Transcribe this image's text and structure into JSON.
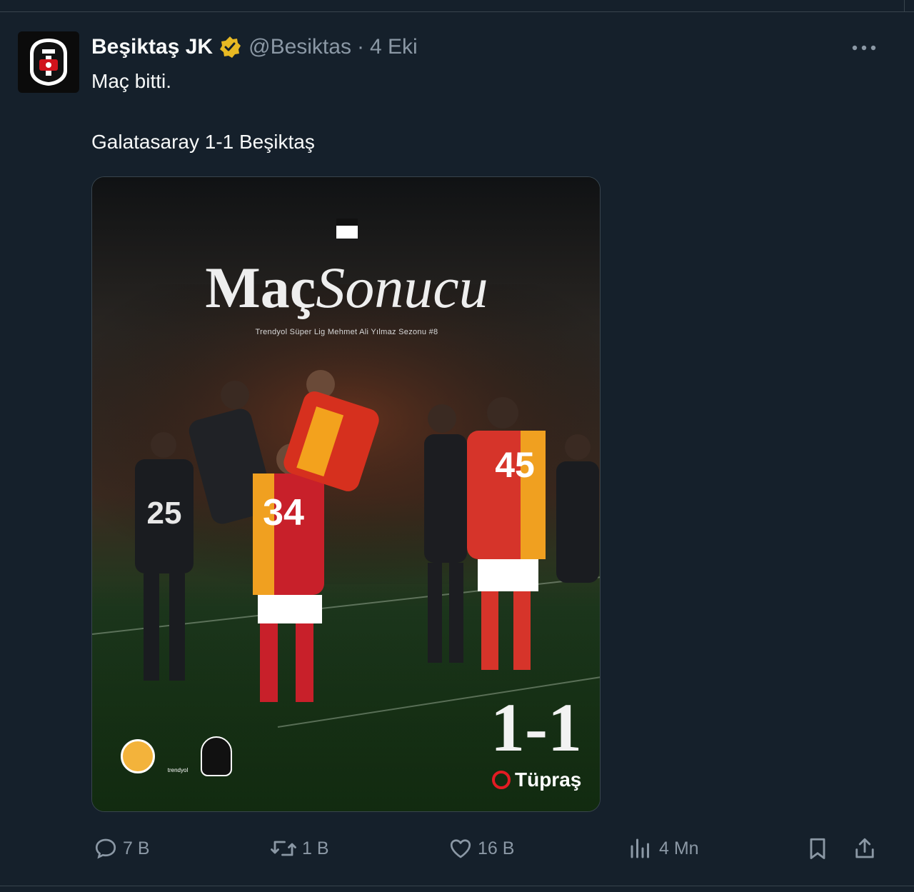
{
  "tweet": {
    "display_name": "Beşiktaş JK",
    "handle": "@Besiktas",
    "separator": "·",
    "date": "4 Eki",
    "text_line1": "Maç bitti.",
    "text_line2": "Galatasaray 1-1 Beşiktaş"
  },
  "media": {
    "title_bold": "Maç",
    "title_italic": "Sonucu",
    "subtitle": "Trendyol Süper Lig Mehmet Ali Yılmaz Sezonu #8",
    "score": "1-1",
    "sponsor": "Tüpraş",
    "league_logo_text": "trendyol"
  },
  "actions": {
    "replies": "7 B",
    "retweets": "1 B",
    "likes": "16 B",
    "views": "4 Mn"
  },
  "colors": {
    "background": "#15202b",
    "secondary_text": "#8b98a5",
    "verified_gold": "#e8b923"
  },
  "icons": [
    "reply-icon",
    "retweet-icon",
    "like-icon",
    "views-icon",
    "bookmark-icon",
    "share-icon",
    "more-icon",
    "verified-badge-icon"
  ]
}
